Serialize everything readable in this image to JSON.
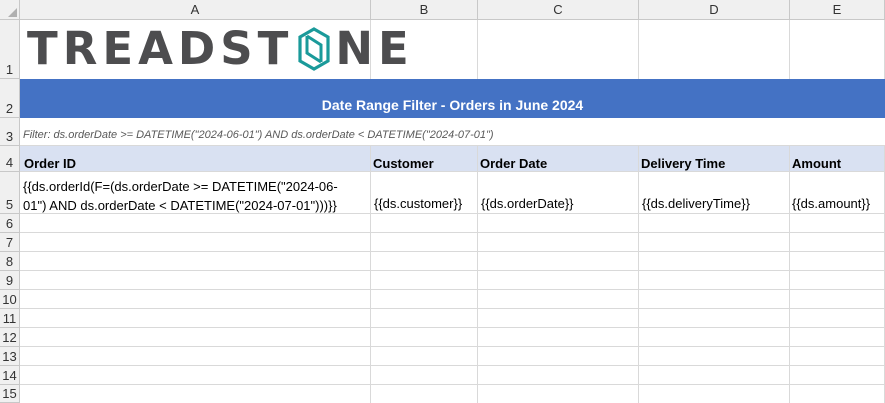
{
  "columns": [
    "A",
    "B",
    "C",
    "D",
    "E"
  ],
  "rows": [
    "1",
    "2",
    "3",
    "4",
    "5",
    "6",
    "7",
    "8",
    "9",
    "10",
    "11",
    "12",
    "13",
    "14",
    "15"
  ],
  "logo": {
    "text_left": "TREADST",
    "text_right": "NE",
    "color": "#4d4d4f",
    "accent": "#1a9a9a"
  },
  "title": "Date Range Filter - Orders in June 2024",
  "filter_note": "Filter: ds.orderDate >= DATETIME(\"2024-06-01\") AND ds.orderDate < DATETIME(\"2024-07-01\")",
  "headers": [
    "Order ID",
    "Customer",
    "Order Date",
    "Delivery Time",
    "Amount"
  ],
  "row5": {
    "order_id_line1": "{{ds.orderId(F=(ds.orderDate >= DATETIME(\"2024-06-",
    "order_id_line2": "01\") AND ds.orderDate < DATETIME(\"2024-07-01\")))}}",
    "customer": "{{ds.customer}}",
    "order_date": "{{ds.orderDate}}",
    "delivery_time": "{{ds.deliveryTime}}",
    "amount": "{{ds.amount}}"
  },
  "colors": {
    "title_band": "#4472c4",
    "header_band": "#d9e1f2"
  }
}
